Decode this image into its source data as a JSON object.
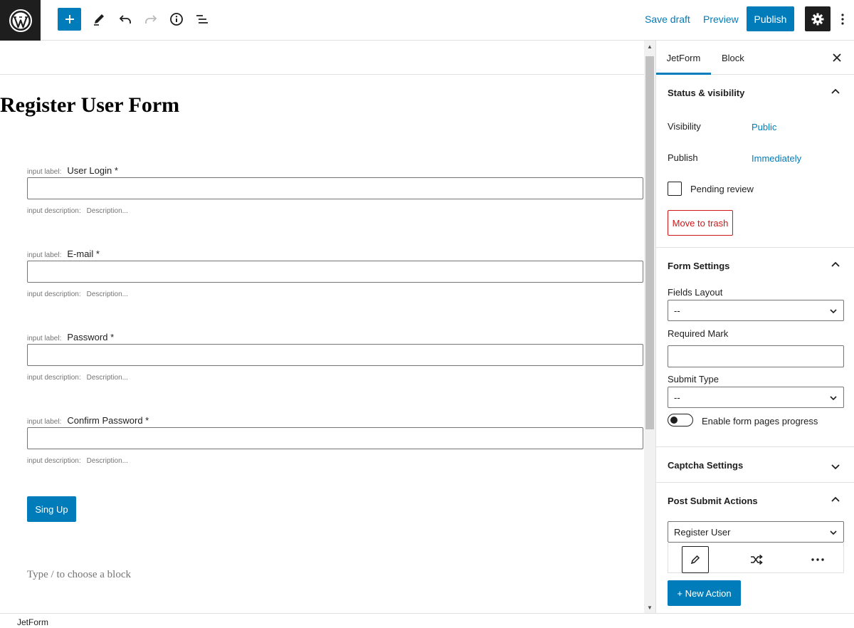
{
  "toolbar": {
    "save_draft": "Save draft",
    "preview": "Preview",
    "publish": "Publish"
  },
  "editor": {
    "title": "Register User Form",
    "input_label_meta": "input label:",
    "input_desc_meta": "input description:",
    "fields": [
      {
        "label": "User Login *",
        "description": "Description..."
      },
      {
        "label": "E-mail *",
        "description": "Description..."
      },
      {
        "label": "Password *",
        "description": "Description..."
      },
      {
        "label": "Confirm Password *",
        "description": "Description..."
      }
    ],
    "submit_label": "Sing Up",
    "appender_placeholder": "Type / to choose a block"
  },
  "sidebar": {
    "tabs": [
      "JetForm",
      "Block"
    ],
    "status": {
      "title": "Status & visibility",
      "visibility_label": "Visibility",
      "visibility_value": "Public",
      "publish_label": "Publish",
      "publish_value": "Immediately",
      "pending_review": "Pending review",
      "move_to_trash": "Move to trash"
    },
    "form_settings": {
      "title": "Form Settings",
      "fields_layout_label": "Fields Layout",
      "fields_layout_value": "--",
      "required_mark_label": "Required Mark",
      "submit_type_label": "Submit Type",
      "submit_type_value": "--",
      "progress_toggle_label": "Enable form pages progress"
    },
    "captcha": {
      "title": "Captcha Settings"
    },
    "post_submit": {
      "title": "Post Submit Actions",
      "action_value": "Register User",
      "new_action": "+ New Action"
    }
  },
  "footer": {
    "breadcrumb": "JetForm"
  },
  "colors": {
    "accent": "#007cba",
    "danger": "#cc1818",
    "dark": "#1e1e1e"
  }
}
